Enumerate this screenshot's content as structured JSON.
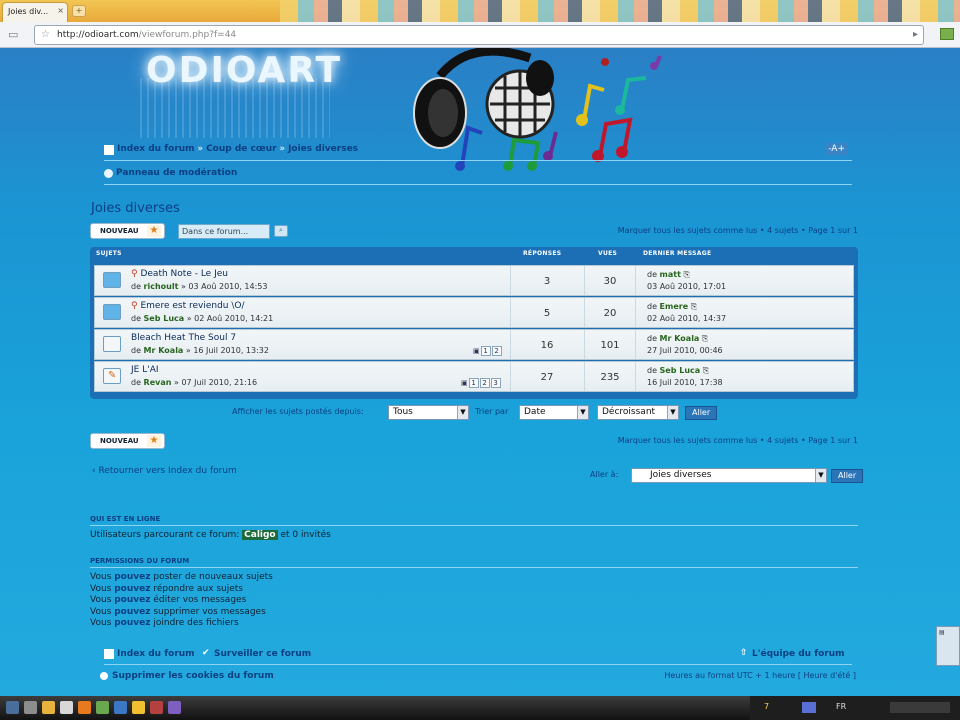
{
  "browser": {
    "tab_title": "Joies div...",
    "tab_close": "×",
    "new_tab": "+",
    "url_host": "http://odioart.com",
    "url_path": "/viewforum.php?f=44"
  },
  "header": {
    "logo": "ODIOART",
    "breadcrumbs": [
      "Index du forum",
      "Coup de cœur",
      "Joies diverses"
    ],
    "breadcrumb_sep": "»",
    "mod_panel": "Panneau de modération"
  },
  "forum": {
    "title": "Joies diverses",
    "new_topic_label": "NOUVEAU",
    "search_placeholder": "Dans ce forum...",
    "mark_read": "Marquer tous les sujets comme lus",
    "topics_count": "4 sujets",
    "page_info": "Page 1 sur 1"
  },
  "table": {
    "headers": {
      "topics": "SUJETS",
      "replies": "RÉPONSES",
      "views": "VUES",
      "last_post": "DERNIER MESSAGE"
    },
    "rows": [
      {
        "title": "Death Note - Le Jeu",
        "author": "richoult",
        "date": "» 03 Aoû 2010, 14:53",
        "replies": "3",
        "views": "30",
        "last_user": "matt",
        "last_date": "03 Aoû 2010, 17:01",
        "pages": []
      },
      {
        "title": "Emere est reviendu \\O/",
        "author": "Seb Luca",
        "date": "» 02 Aoû 2010, 14:21",
        "replies": "5",
        "views": "20",
        "last_user": "Emere",
        "last_date": "02 Aoû 2010, 14:37",
        "pages": []
      },
      {
        "title": "Bleach Heat The Soul 7",
        "author": "Mr Koala",
        "date": "» 16 Juil 2010, 13:32",
        "replies": "16",
        "views": "101",
        "last_user": "Mr Koala",
        "last_date": "27 Juil 2010, 00:46",
        "pages": [
          "1",
          "2"
        ]
      },
      {
        "title": "JE L'AI",
        "author": "Revan",
        "date": "» 07 Juil 2010, 21:16",
        "replies": "27",
        "views": "235",
        "last_user": "Seb Luca",
        "last_date": "16 Juil 2010, 17:38",
        "pages": [
          "1",
          "2",
          "3"
        ]
      }
    ],
    "by_label": "de"
  },
  "sort": {
    "label": "Afficher les sujets postés depuis:",
    "time_value": "Tous",
    "sort_by_label": "Trier par",
    "sort_value": "Date",
    "order_value": "Décroissant",
    "go": "Aller"
  },
  "bottom": {
    "return_link": "‹ Retourner vers Index du forum",
    "jump_label": "Aller à:",
    "jump_value": "Joies diverses",
    "jump_go": "Aller"
  },
  "online": {
    "heading": "QUI EST EN LIGNE",
    "text_before": "Utilisateurs parcourant ce forum:",
    "user": "Caligo",
    "text_after": "et 0 invités"
  },
  "permissions": {
    "heading": "PERMISSIONS DU FORUM",
    "lines": [
      {
        "pre": "Vous",
        "bold": "pouvez",
        "post": "poster de nouveaux sujets"
      },
      {
        "pre": "Vous",
        "bold": "pouvez",
        "post": "répondre aux sujets"
      },
      {
        "pre": "Vous",
        "bold": "pouvez",
        "post": "éditer vos messages"
      },
      {
        "pre": "Vous",
        "bold": "pouvez",
        "post": "supprimer vos messages"
      },
      {
        "pre": "Vous",
        "bold": "pouvez",
        "post": "joindre des fichiers"
      }
    ]
  },
  "footer": {
    "index": "Index du forum",
    "watch": "Surveiller ce forum",
    "team": "L'équipe du forum",
    "delete_cookies": "Supprimer les cookies du forum",
    "timezone": "Heures au format UTC + 1 heure [ Heure d'été ]"
  },
  "taskbar": {
    "tray_text": "FR",
    "counter": "7"
  },
  "colors": {
    "page_bg": "#1aa3da",
    "link": "#0b3f82",
    "user_green": "#27651e",
    "table_header": "#1c6fb5"
  }
}
